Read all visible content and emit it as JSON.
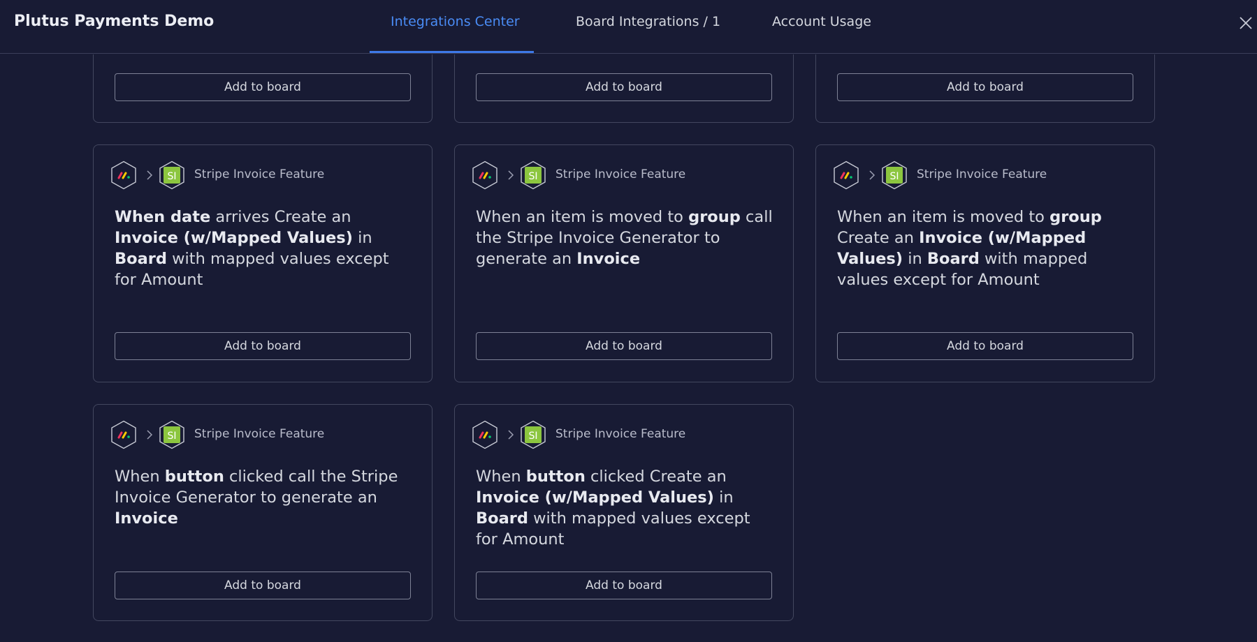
{
  "app": {
    "title": "Plutus Payments Demo"
  },
  "tabs": [
    {
      "label": "Integrations Center",
      "active": true
    },
    {
      "label": "Board Integrations / 1",
      "active": false
    },
    {
      "label": "Account Usage",
      "active": false
    }
  ],
  "icons": {
    "close": "close-icon",
    "source": "monday-logo-icon",
    "chevron": "chevron-right-icon",
    "target": "stripe-invoice-si-icon"
  },
  "colors": {
    "background": "#181b34",
    "accent": "#4a8cf5",
    "si_badge": "#8cc63f"
  },
  "cards": [
    {
      "button": "Add to board"
    },
    {
      "button": "Add to board"
    },
    {
      "button": "Add to board"
    },
    {
      "feature": "Stripe Invoice Feature",
      "parts": [
        {
          "t": "When ",
          "b": true
        },
        {
          "t": "date",
          "b": true
        },
        {
          "t": " arrives Create an "
        },
        {
          "t": "Invoice (w/Mapped Values)",
          "b": true
        },
        {
          "t": " in "
        },
        {
          "t": "Board",
          "b": true
        },
        {
          "t": " with mapped values except for Amount"
        }
      ],
      "button": "Add to board"
    },
    {
      "feature": "Stripe Invoice Feature",
      "parts": [
        {
          "t": "When an item is moved to "
        },
        {
          "t": "group",
          "b": true
        },
        {
          "t": " call the Stripe Invoice Generator to generate an "
        },
        {
          "t": "Invoice",
          "b": true
        }
      ],
      "button": "Add to board"
    },
    {
      "feature": "Stripe Invoice Feature",
      "parts": [
        {
          "t": "When an item is moved to "
        },
        {
          "t": "group",
          "b": true
        },
        {
          "t": " Create an "
        },
        {
          "t": "Invoice (w/Mapped Values)",
          "b": true
        },
        {
          "t": " in "
        },
        {
          "t": "Board",
          "b": true
        },
        {
          "t": " with mapped values except for Amount"
        }
      ],
      "button": "Add to board"
    },
    {
      "feature": "Stripe Invoice Feature",
      "parts": [
        {
          "t": "When "
        },
        {
          "t": "button",
          "b": true
        },
        {
          "t": " clicked call the Stripe Invoice Generator to generate an "
        },
        {
          "t": "Invoice",
          "b": true
        }
      ],
      "button": "Add to board"
    },
    {
      "feature": "Stripe Invoice Feature",
      "parts": [
        {
          "t": "When "
        },
        {
          "t": "button",
          "b": true
        },
        {
          "t": " clicked Create an "
        },
        {
          "t": "Invoice (w/Mapped Values)",
          "b": true
        },
        {
          "t": " in "
        },
        {
          "t": "Board",
          "b": true
        },
        {
          "t": " with mapped values except for Amount"
        }
      ],
      "button": "Add to board"
    }
  ]
}
